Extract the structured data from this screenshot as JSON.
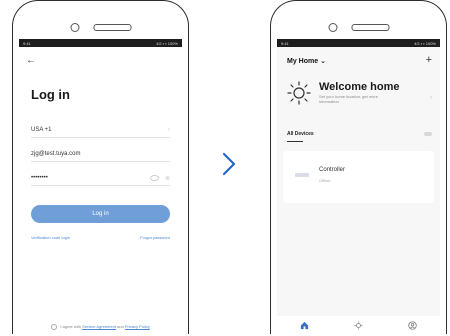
{
  "login_screen": {
    "status_left": "9:41",
    "status_right": "4G ▪ ▪ 100%",
    "title": "Log in",
    "country_value": "USA +1",
    "email_value": "zjg@test.tuya.com",
    "password_value": "••••••••",
    "button_label": "Log in",
    "link_verification": "Verification code login",
    "link_forgot": "Forgot password",
    "agreement_prefix": "I agree with",
    "service_agreement": "Service Agreement",
    "agreement_and": "and",
    "privacy_policy": "Privacy Policy"
  },
  "home_screen": {
    "status_left": "9:41",
    "status_right": "4G ▪ ▪ 100%",
    "home_name": "My Home",
    "welcome_title": "Welcome home",
    "welcome_subtitle": "Set your home location, get more information",
    "devices_label": "All Devices",
    "device_name": "Controller",
    "device_status": "Offline",
    "tabs": [
      "home-icon",
      "scene-icon",
      "me-icon"
    ]
  },
  "colors": {
    "primary_blue": "#6f9ed8",
    "link_blue": "#4a86d1",
    "tab_active": "#3a6fc0",
    "chevron": "#2566c9"
  }
}
